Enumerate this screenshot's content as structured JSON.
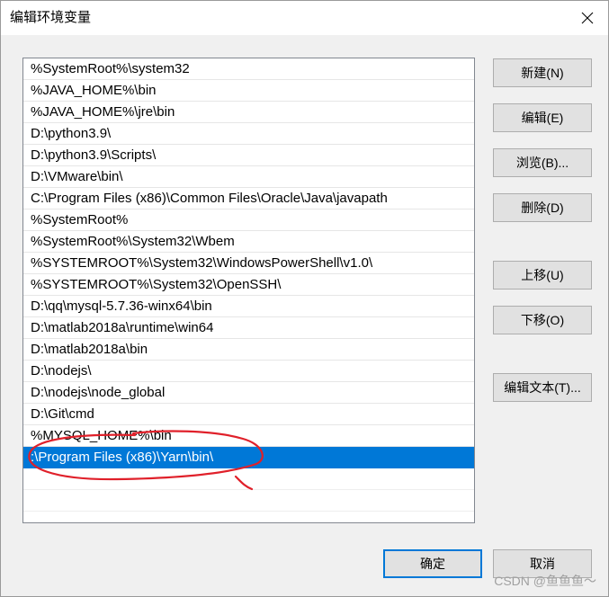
{
  "window": {
    "title": "编辑环境变量",
    "close_icon": "close-icon"
  },
  "path_list": {
    "items": [
      "%SystemRoot%\\system32",
      "%JAVA_HOME%\\bin",
      "%JAVA_HOME%\\jre\\bin",
      "D:\\python3.9\\",
      "D:\\python3.9\\Scripts\\",
      "D:\\VMware\\bin\\",
      "C:\\Program Files (x86)\\Common Files\\Oracle\\Java\\javapath",
      "%SystemRoot%",
      "%SystemRoot%\\System32\\Wbem",
      "%SYSTEMROOT%\\System32\\WindowsPowerShell\\v1.0\\",
      "%SYSTEMROOT%\\System32\\OpenSSH\\",
      "D:\\qq\\mysql-5.7.36-winx64\\bin",
      "D:\\matlab2018a\\runtime\\win64",
      "D:\\matlab2018a\\bin",
      "D:\\nodejs\\",
      "D:\\nodejs\\node_global",
      "D:\\Git\\cmd",
      "%MYSQL_HOME%\\bin",
      ":\\Program Files (x86)\\Yarn\\bin\\"
    ],
    "selected_index": 18,
    "selection_color": "#0078d7"
  },
  "buttons": {
    "new": "新建(N)",
    "edit": "编辑(E)",
    "browse": "浏览(B)...",
    "delete": "删除(D)",
    "move_up": "上移(U)",
    "move_down": "下移(O)",
    "edit_text": "编辑文本(T)...",
    "ok": "确定",
    "cancel": "取消"
  },
  "annotation_color": "#e0202a",
  "watermark": "CSDN @鱼鱼鱼～"
}
